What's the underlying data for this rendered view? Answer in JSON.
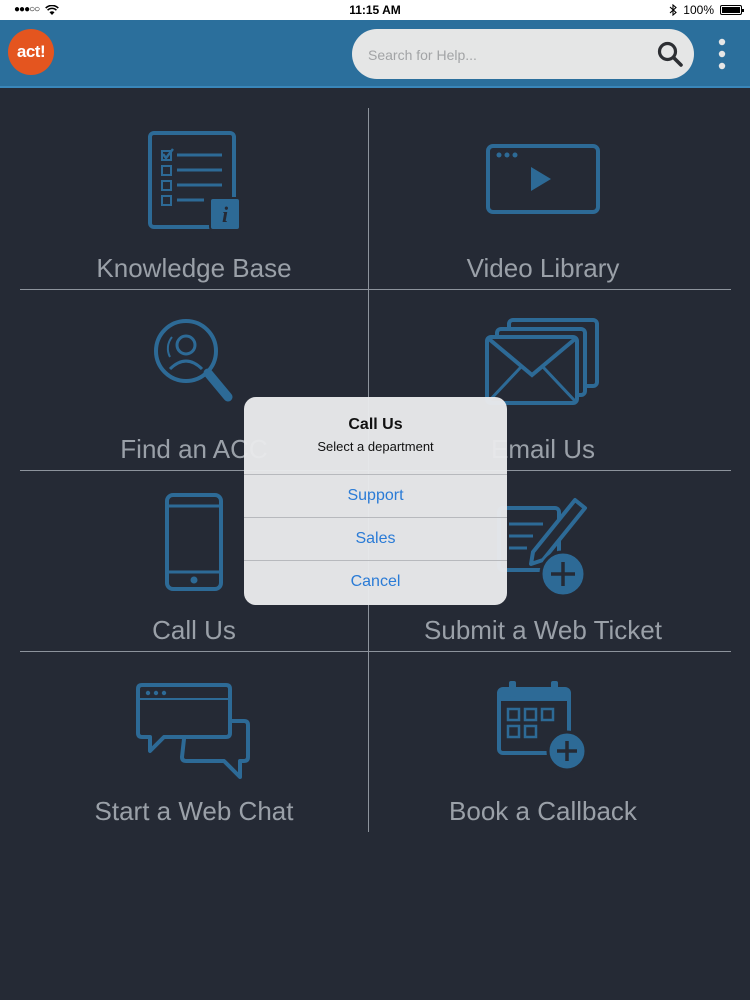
{
  "status_bar": {
    "signal": "●●●○○",
    "time": "11:15 AM",
    "battery": "100%",
    "icons": [
      "wifi-icon",
      "bluetooth-icon",
      "battery-icon"
    ]
  },
  "header": {
    "logo_text": "act!",
    "search_placeholder": "Search for Help...",
    "search_value": "",
    "menu_icon": "more-vertical-icon",
    "colors": {
      "bar": "#2b6f9c",
      "logo": "#e4551f"
    }
  },
  "tiles": [
    {
      "label": "Knowledge Base",
      "icon": "knowledge-base-icon"
    },
    {
      "label": "Video Library",
      "icon": "video-library-icon"
    },
    {
      "label": "Find an ACC",
      "icon": "find-consultant-icon"
    },
    {
      "label": "Email Us",
      "icon": "email-icon"
    },
    {
      "label": "Call Us",
      "icon": "phone-icon"
    },
    {
      "label": "Submit a Web Ticket",
      "icon": "web-ticket-icon"
    },
    {
      "label": "Start a Web Chat",
      "icon": "web-chat-icon"
    },
    {
      "label": "Book a Callback",
      "icon": "callback-calendar-icon"
    }
  ],
  "dialog": {
    "title": "Call Us",
    "message": "Select a department",
    "buttons": [
      "Support",
      "Sales",
      "Cancel"
    ]
  },
  "colors": {
    "background": "#252a35",
    "icon": "#2d6a96",
    "label": "#9aa0a8",
    "divider": "#8d939c",
    "action": "#2a7bd6"
  }
}
